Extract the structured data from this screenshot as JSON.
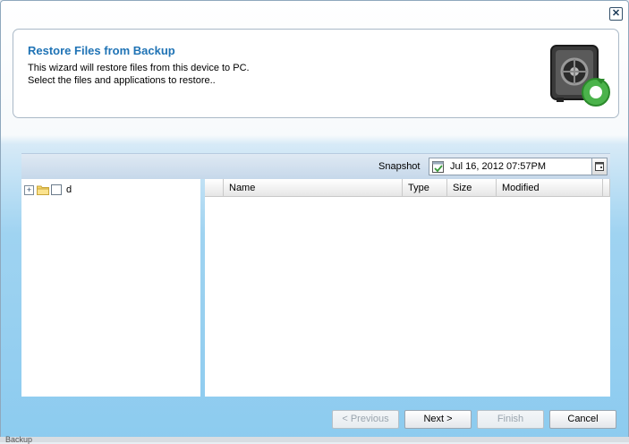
{
  "window": {
    "close_glyph": "✕"
  },
  "header": {
    "title": "Restore Files from Backup",
    "description_line1": "This wizard will restore files from this device to PC.",
    "description_line2": "Select the files and applications to restore..",
    "icon": "safe-restore-icon"
  },
  "snapshot": {
    "label": "Snapshot",
    "value": "Jul 16, 2012 07:57PM",
    "icon": "calendar-icon"
  },
  "tree": {
    "items": [
      {
        "label": "d",
        "expander": "+"
      }
    ]
  },
  "files": {
    "columns": [
      "Name",
      "Type",
      "Size",
      "Modified"
    ],
    "rows": []
  },
  "buttons": {
    "previous": "< Previous",
    "next": "Next >",
    "finish": "Finish",
    "cancel": "Cancel"
  },
  "background_text": "Backup",
  "colors": {
    "title": "#1f73b5",
    "background_blue": "#8ccbef"
  }
}
